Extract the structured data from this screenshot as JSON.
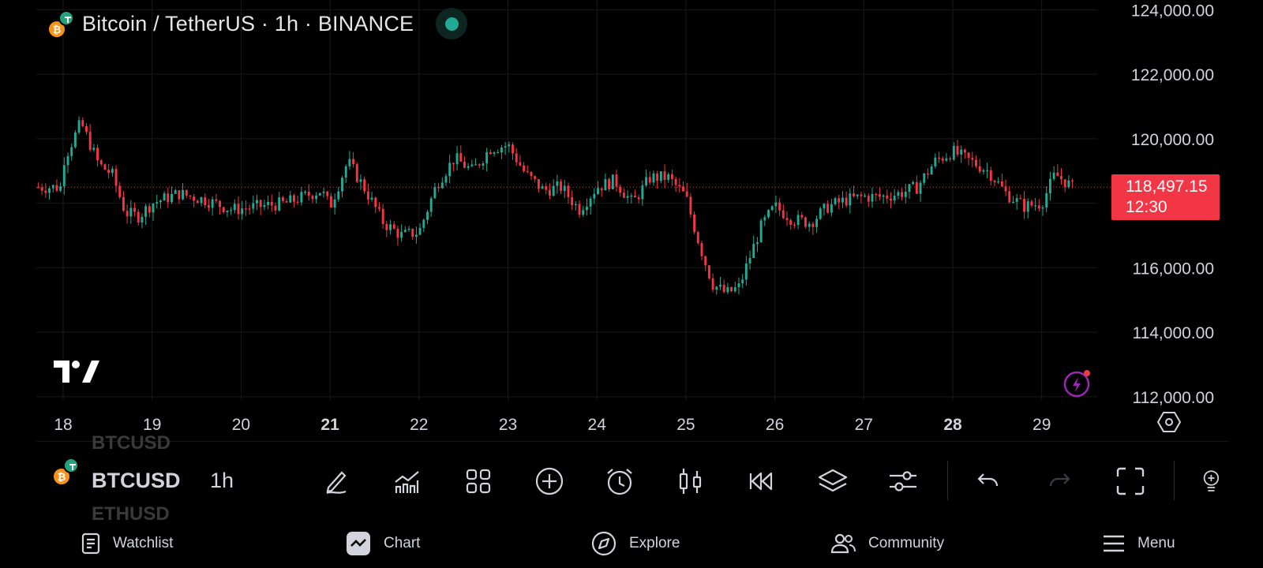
{
  "header": {
    "title": "Bitcoin / TetherUS · 1h · BINANCE",
    "base_icon": "bitcoin-icon",
    "quote_icon": "tether-icon",
    "status": "live-status-dot"
  },
  "colors": {
    "background": "#000000",
    "up": "#22ab94",
    "down": "#f23645",
    "text": "#d1d4dc",
    "grid": "#1a1a1a"
  },
  "chart_data": {
    "type": "candlestick",
    "symbol": "BTCUSDT",
    "interval": "1h",
    "x_tick_labels": [
      "18",
      "19",
      "20",
      "21",
      "22",
      "23",
      "24",
      "25",
      "26",
      "27",
      "28",
      "29"
    ],
    "x_tick_bold": [
      "21",
      "28"
    ],
    "y_tick_labels": [
      "124,000.00",
      "122,000.00",
      "120,000.00",
      "116,000.00",
      "114,000.00",
      "112,000.00"
    ],
    "y_ticks": [
      124000,
      122000,
      120000,
      118000,
      116000,
      114000,
      112000
    ],
    "ylim": [
      111900,
      124300
    ],
    "last_price": 118497.15,
    "last_price_label": "118,497.15",
    "countdown": "12:30",
    "close_path": [
      [
        "18",
        119300
      ],
      [
        "18.2",
        120500
      ],
      [
        "18.4",
        119200
      ],
      [
        "18.55",
        118900
      ],
      [
        "18.7",
        117700
      ],
      [
        "18.85",
        117600
      ],
      [
        "19",
        118000
      ],
      [
        "19.3",
        118300
      ],
      [
        "19.6",
        118100
      ],
      [
        "19.9",
        117800
      ],
      [
        "20.2",
        117900
      ],
      [
        "20.5",
        118000
      ],
      [
        "20.7",
        118200
      ],
      [
        "20.9",
        118400
      ],
      [
        "21",
        117900
      ],
      [
        "21.2",
        119300
      ],
      [
        "21.4",
        118400
      ],
      [
        "21.6",
        117400
      ],
      [
        "21.8",
        117000
      ],
      [
        "22",
        117100
      ],
      [
        "22.2",
        118600
      ],
      [
        "22.4",
        119400
      ],
      [
        "22.6",
        119000
      ],
      [
        "22.8",
        119700
      ],
      [
        "23",
        119800
      ],
      [
        "23.2",
        118900
      ],
      [
        "23.4",
        118400
      ],
      [
        "23.6",
        118500
      ],
      [
        "23.8",
        117800
      ],
      [
        "24",
        118500
      ],
      [
        "24.2",
        118700
      ],
      [
        "24.4",
        118000
      ],
      [
        "24.6",
        118800
      ],
      [
        "24.8",
        118800
      ],
      [
        "25",
        118200
      ],
      [
        "25.1",
        117200
      ],
      [
        "25.2",
        116300
      ],
      [
        "25.3",
        115500
      ],
      [
        "25.45",
        115200
      ],
      [
        "25.6",
        115400
      ],
      [
        "25.7",
        116200
      ],
      [
        "25.85",
        117300
      ],
      [
        "26",
        117900
      ],
      [
        "26.2",
        117500
      ],
      [
        "26.4",
        117400
      ],
      [
        "26.6",
        117900
      ],
      [
        "26.8",
        118100
      ],
      [
        "27",
        118200
      ],
      [
        "27.2",
        118200
      ],
      [
        "27.4",
        118300
      ],
      [
        "27.6",
        118500
      ],
      [
        "27.8",
        119300
      ],
      [
        "28",
        119600
      ],
      [
        "28.2",
        119300
      ],
      [
        "28.4",
        119000
      ],
      [
        "28.6",
        118300
      ],
      [
        "28.8",
        117900
      ],
      [
        "29",
        118000
      ],
      [
        "29.15",
        118900
      ],
      [
        "29.35",
        118497
      ]
    ]
  },
  "toolbar": {
    "symbol_prev": "BTCUSD",
    "symbol_current": "BTCUSD",
    "symbol_next": "ETHUSD",
    "timeframe": "1h",
    "icons": [
      "draw-pencil-icon",
      "indicators-icon",
      "layouts-icon",
      "add-icon",
      "alert-clock-icon",
      "candles-icon",
      "replay-icon",
      "layers-icon",
      "settings-sliders-icon",
      "undo-icon",
      "redo-icon",
      "fullscreen-icon",
      "ideas-icon"
    ]
  },
  "nav": {
    "watchlist": "Watchlist",
    "chart": "Chart",
    "explore": "Explore",
    "community": "Community",
    "menu": "Menu"
  }
}
